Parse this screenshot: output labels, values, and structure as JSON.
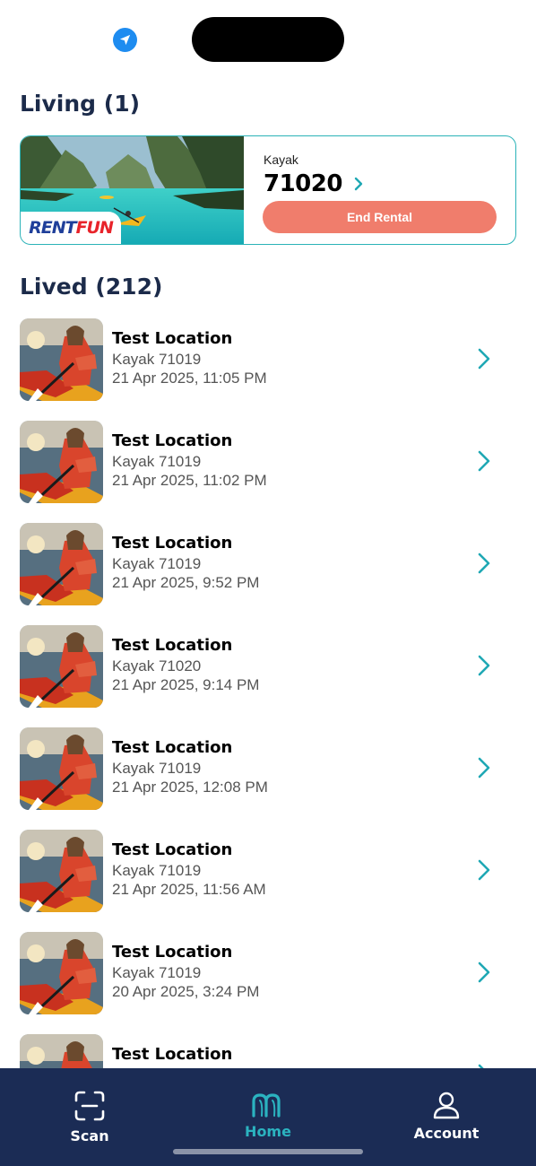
{
  "colors": {
    "accent": "#2bb3b8",
    "end_rental": "#f07d6c",
    "nav_background": "#1b2c55",
    "title": "#1c2b4a"
  },
  "status_bar": {
    "location_icon": "location-arrow-icon"
  },
  "living": {
    "title": "Living (1)",
    "rental": {
      "brand_rent": "RENT",
      "brand_fun": "FUN",
      "vehicle_type": "Kayak",
      "vehicle_id": "71020",
      "end_button": "End Rental"
    }
  },
  "lived": {
    "title": "Lived (212)",
    "items": [
      {
        "location": "Test Location",
        "vehicle": "Kayak  71019",
        "date": "21 Apr 2025, 11:05 PM"
      },
      {
        "location": "Test Location",
        "vehicle": "Kayak  71019",
        "date": "21 Apr 2025, 11:02 PM"
      },
      {
        "location": "Test Location",
        "vehicle": "Kayak  71019",
        "date": "21 Apr 2025, 9:52 PM"
      },
      {
        "location": "Test Location",
        "vehicle": "Kayak  71020",
        "date": "21 Apr 2025, 9:14 PM"
      },
      {
        "location": "Test Location",
        "vehicle": "Kayak  71019",
        "date": "21 Apr 2025, 12:08 PM"
      },
      {
        "location": "Test Location",
        "vehicle": "Kayak  71019",
        "date": "21 Apr 2025, 11:56 AM"
      },
      {
        "location": "Test Location",
        "vehicle": "Kayak  71019",
        "date": "20 Apr 2025, 3:24 PM"
      },
      {
        "location": "Test Location",
        "vehicle": "",
        "date": ""
      }
    ]
  },
  "nav": {
    "scan": {
      "label": "Scan",
      "icon": "scan-icon"
    },
    "home": {
      "label": "Home",
      "icon": "home-logo-icon"
    },
    "account": {
      "label": "Account",
      "icon": "user-icon"
    }
  }
}
